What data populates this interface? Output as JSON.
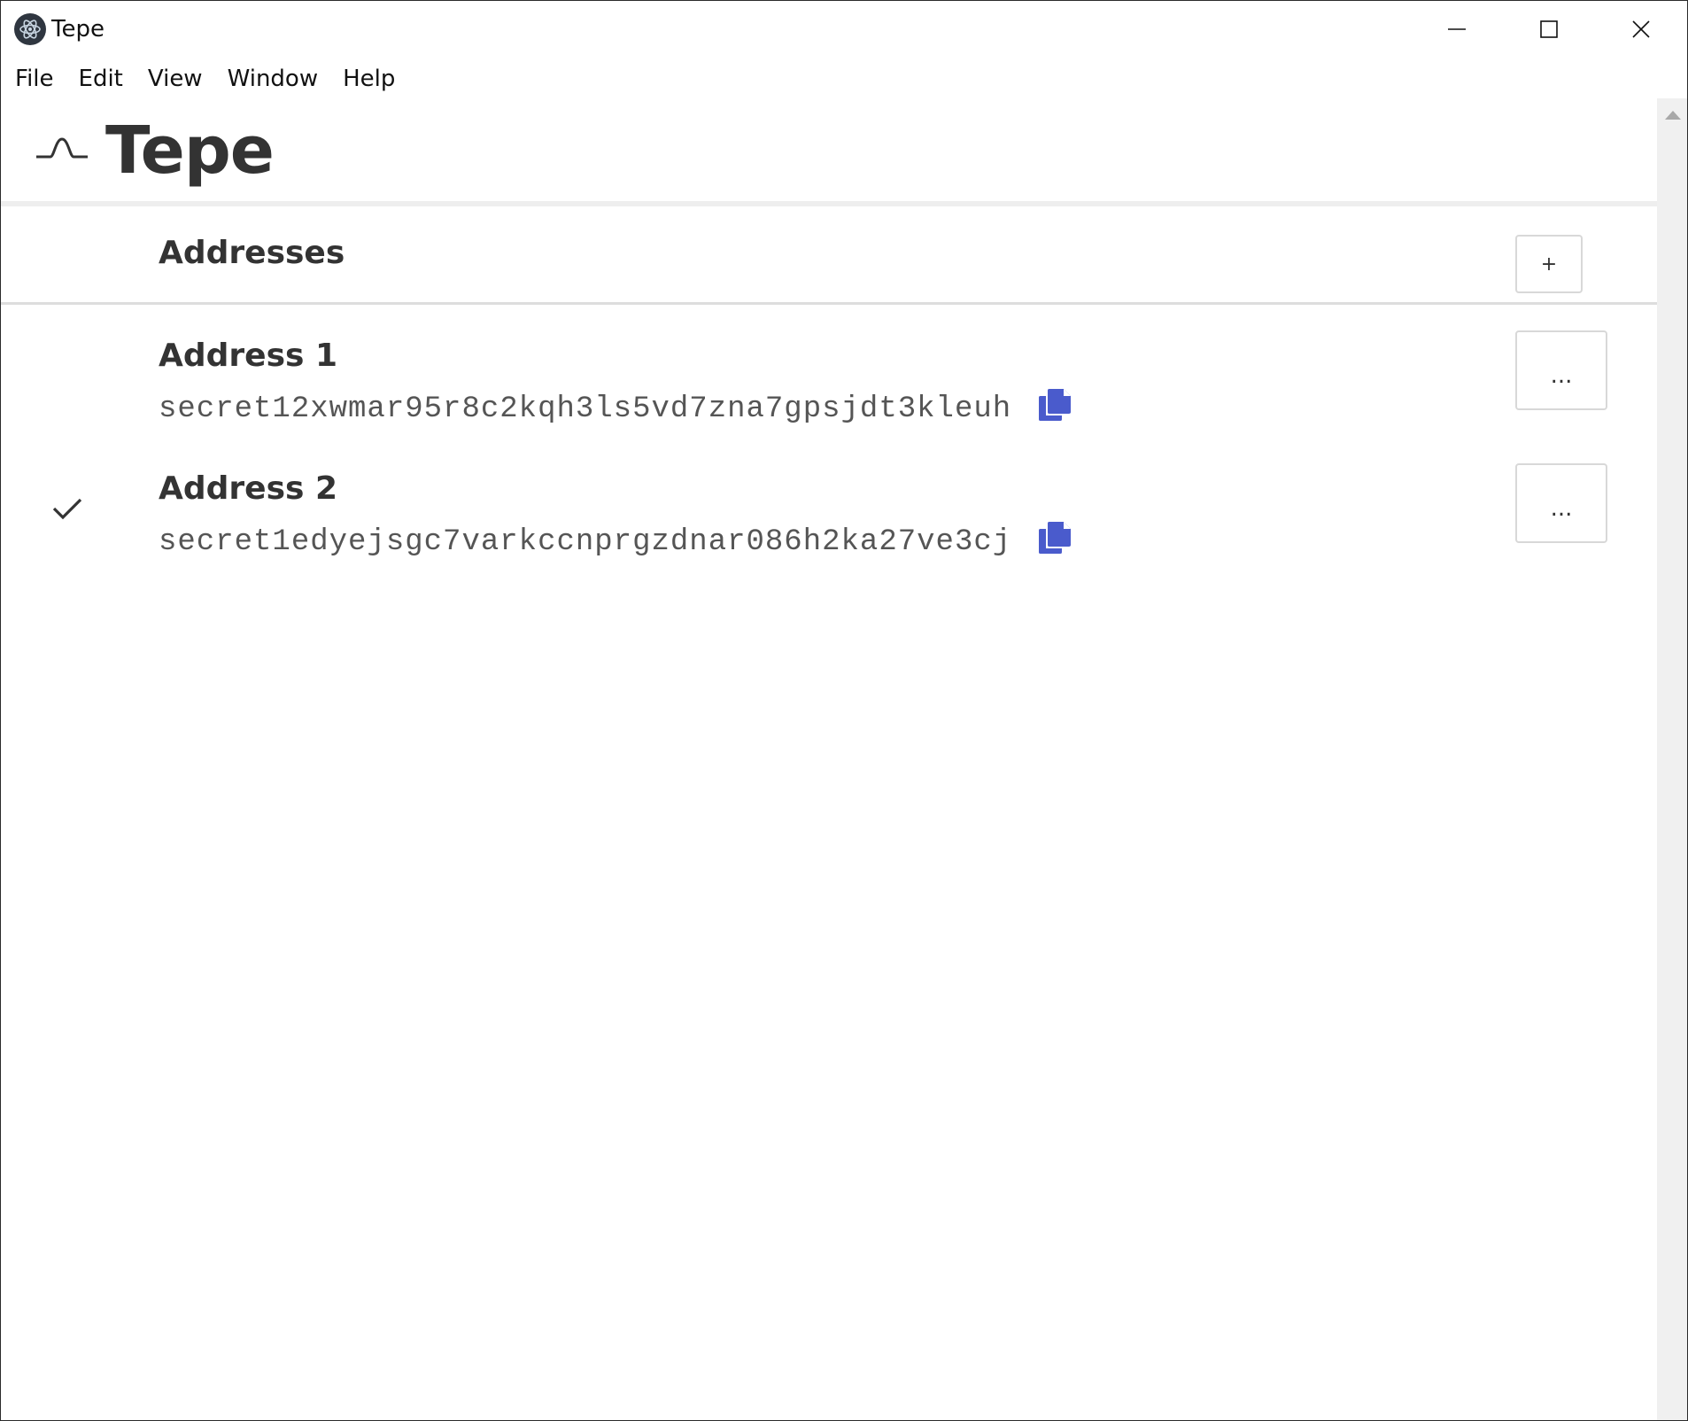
{
  "window": {
    "title": "Tepe"
  },
  "menu": {
    "items": [
      "File",
      "Edit",
      "View",
      "Window",
      "Help"
    ]
  },
  "app": {
    "name": "Tepe"
  },
  "addresses_section": {
    "title": "Addresses",
    "add_label": "+"
  },
  "addresses": [
    {
      "name": "Address 1",
      "value": "secret12xwmar95r8c2kqh3ls5vd7zna7gpsjdt3kleuh",
      "selected": false,
      "more_label": "..."
    },
    {
      "name": "Address 2",
      "value": "secret1edyejsgc7varkccnprgzdnar086h2ka27ve3cj",
      "selected": true,
      "more_label": "..."
    }
  ],
  "colors": {
    "copy_icon": "#4a5bcc",
    "text": "#333333",
    "divider": "#dddddd"
  }
}
